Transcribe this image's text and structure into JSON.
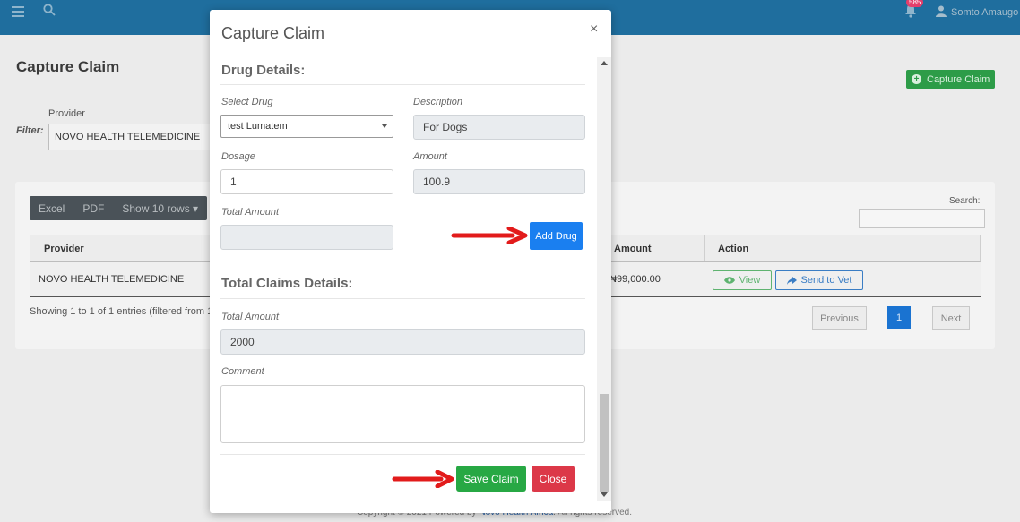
{
  "topbar": {
    "notification_count": "585",
    "user_name": "Somto Amaugo"
  },
  "page": {
    "title": "Capture Claim",
    "capture_button": "Capture Claim",
    "filter_label": "Filter:",
    "provider_label": "Provider",
    "provider_value": "NOVO HEALTH TELEMEDICINE",
    "toolbar": {
      "excel": "Excel",
      "pdf": "PDF",
      "show_rows": "Show 10 rows"
    },
    "search_label": "Search:",
    "table": {
      "headers": [
        "Provider",
        "Amount",
        "Action"
      ],
      "rows": [
        {
          "provider": "NOVO HEALTH TELEMEDICINE",
          "amount": "₦99,000.00",
          "view": "View",
          "send": "Send to Vet"
        }
      ]
    },
    "showing_text": "Showing 1 to 1 of 1 entries (filtered from 1",
    "pagination": {
      "previous": "Previous",
      "current": "1",
      "next": "Next"
    },
    "footer": {
      "prefix": "Copyright © 2021 Powered by ",
      "link": "Novo Health Africa",
      "suffix": ". All rights reserved."
    }
  },
  "modal": {
    "title": "Capture Claim",
    "close_glyph": "×",
    "drug_section": "Drug Details:",
    "select_drug_label": "Select Drug",
    "select_drug_value": "test Lumatem",
    "description_label": "Description",
    "description_value": "For Dogs",
    "dosage_label": "Dosage",
    "dosage_value": "1",
    "amount_label": "Amount",
    "amount_value": "100.9",
    "total_amount_label": "Total Amount",
    "total_amount_value": "",
    "add_drug": "Add Drug",
    "claims_section": "Total Claims Details:",
    "claims_total_label": "Total Amount",
    "claims_total_value": "2000",
    "comment_label": "Comment",
    "comment_value": "",
    "save": "Save Claim",
    "close": "Close"
  },
  "colors": {
    "arrow": "#e21b1b",
    "primary": "#1a7ff0",
    "success": "#27a844",
    "danger": "#dc3848"
  }
}
